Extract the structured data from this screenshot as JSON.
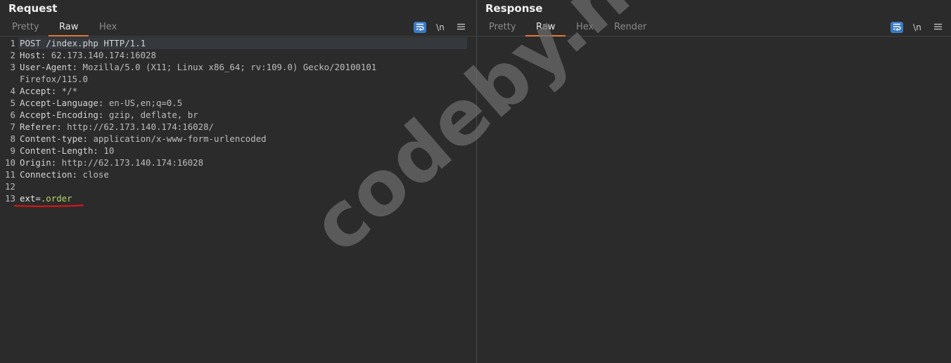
{
  "request": {
    "title": "Request",
    "tabs": [
      "Pretty",
      "Raw",
      "Hex"
    ],
    "active_tab": "Raw",
    "tools": {
      "wrap_icon": "wrap-lines-icon",
      "newline_label": "\\n",
      "menu_icon": "hamburger-menu-icon"
    },
    "lines": [
      {
        "n": "1",
        "name": "POST /index.php HTTP/1.1",
        "value": ""
      },
      {
        "n": "2",
        "name": "Host:",
        "value": " 62.173.140.174:16028"
      },
      {
        "n": "3",
        "name": "User-Agent:",
        "value": " Mozilla/5.0 (X11; Linux x86_64; rv:109.0) Gecko/20100101"
      },
      {
        "n": "",
        "name": "",
        "value": "Firefox/115.0"
      },
      {
        "n": "4",
        "name": "Accept:",
        "value": " */*"
      },
      {
        "n": "5",
        "name": "Accept-Language:",
        "value": " en-US,en;q=0.5"
      },
      {
        "n": "6",
        "name": "Accept-Encoding:",
        "value": " gzip, deflate, br"
      },
      {
        "n": "7",
        "name": "Referer:",
        "value": " http://62.173.140.174:16028/"
      },
      {
        "n": "8",
        "name": "Content-type:",
        "value": " application/x-www-form-urlencoded"
      },
      {
        "n": "9",
        "name": "Content-Length:",
        "value": " 10"
      },
      {
        "n": "10",
        "name": "Origin:",
        "value": " http://62.173.140.174:16028"
      },
      {
        "n": "11",
        "name": "Connection:",
        "value": " close"
      },
      {
        "n": "12",
        "name": "",
        "value": ""
      },
      {
        "n": "13",
        "name": "ext=",
        "value": ".order"
      }
    ]
  },
  "response": {
    "title": "Response",
    "tabs": [
      "Pretty",
      "Raw",
      "Hex",
      "Render"
    ],
    "active_tab": "Raw",
    "tools": {
      "wrap_icon": "wrap-lines-icon",
      "newline_label": "\\n",
      "menu_icon": "hamburger-menu-icon"
    }
  },
  "layout_buttons": [
    "split-horizontal-icon",
    "split-vertical-icon",
    "single-pane-icon"
  ],
  "watermark": "codeby.net",
  "colors": {
    "accent": "#e07b3c",
    "blue": "#3a7bc4",
    "param_value": "#b5d86a",
    "annotation": "#d01818"
  }
}
